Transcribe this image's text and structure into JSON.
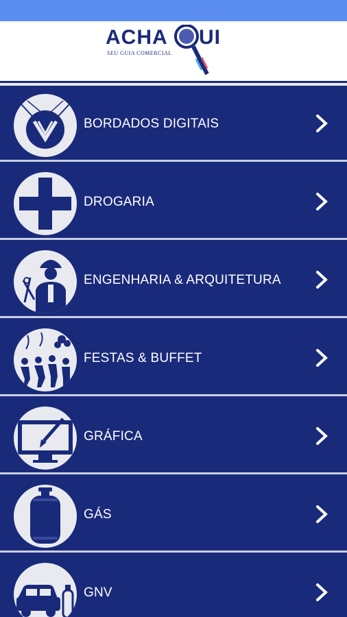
{
  "header": {
    "logo_text": "ACHAQUI",
    "logo_subtitle": "SEU GUIA COMERCIAL"
  },
  "colors": {
    "status_bar": "#5b8ef0",
    "header_bg": "#ffffff",
    "list_bg": "#1a2a7a",
    "divider": "#c9cfe6",
    "icon_circle": "#e8eaf0",
    "icon_fg": "#1a2a7a"
  },
  "categories": [
    {
      "label": "BORDADOS DIGITAIS",
      "icon": "embroidery-icon"
    },
    {
      "label": "DROGARIA",
      "icon": "pharmacy-cross-icon"
    },
    {
      "label": "ENGENHARIA & ARQUITETURA",
      "icon": "engineer-icon"
    },
    {
      "label": "FESTAS & BUFFET",
      "icon": "party-icon"
    },
    {
      "label": "GRÁFICA",
      "icon": "graphic-design-icon"
    },
    {
      "label": "GÁS",
      "icon": "gas-cylinder-icon"
    },
    {
      "label": "GNV",
      "icon": "car-gnv-icon"
    }
  ]
}
